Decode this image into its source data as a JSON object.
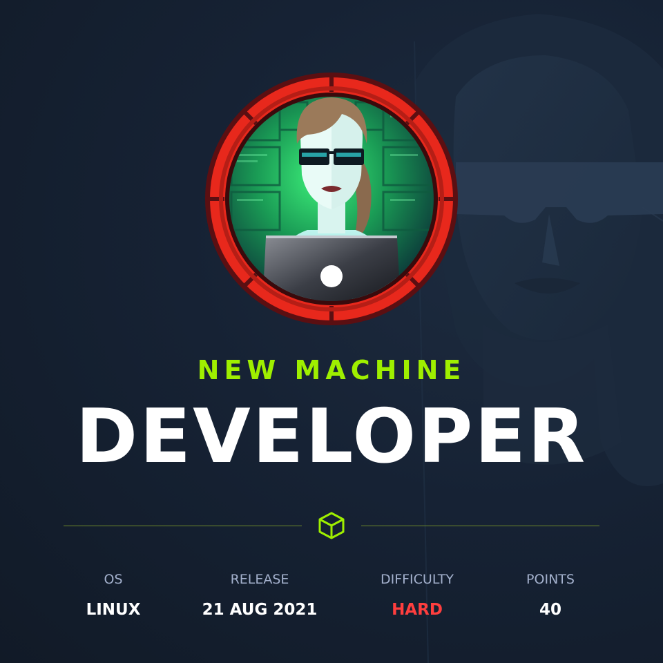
{
  "tagline": "NEW MACHINE",
  "title": "DEVELOPER",
  "icons": {
    "badge": "developer-avatar-badge-icon",
    "divider": "cube-icon"
  },
  "colors": {
    "accent_green": "#9fef00",
    "difficulty_hard": "#ff3e3e",
    "badge_ring": "#e8281c"
  },
  "stats": [
    {
      "label": "OS",
      "value": "LINUX"
    },
    {
      "label": "RELEASE",
      "value": "21 AUG 2021"
    },
    {
      "label": "DIFFICULTY",
      "value": "HARD"
    },
    {
      "label": "POINTS",
      "value": "40"
    }
  ]
}
